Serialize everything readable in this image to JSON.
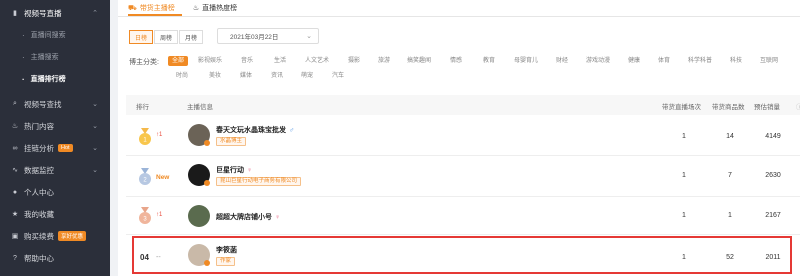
{
  "sidebar": {
    "items": [
      {
        "icon": "chart-icon",
        "label": "视频号直播"
      },
      {
        "icon": "search-icon",
        "label": "视频号查找"
      },
      {
        "icon": "fire-icon",
        "label": "热门内容"
      },
      {
        "icon": "link-icon",
        "label": "挂链分析",
        "badge": "Hot"
      },
      {
        "icon": "monitor-icon",
        "label": "数据监控"
      },
      {
        "icon": "user-icon",
        "label": "个人中心"
      },
      {
        "icon": "star-icon",
        "label": "我的收藏"
      },
      {
        "icon": "cart-icon",
        "label": "购买续费",
        "badge": "享好优惠"
      },
      {
        "icon": "help-icon",
        "label": "帮助中心"
      }
    ],
    "sub_items": [
      "直播间搜索",
      "主播搜索",
      "直播排行榜"
    ]
  },
  "tabs": [
    "带货主播榜",
    "直播热度榜"
  ],
  "periods": [
    "日榜",
    "周榜",
    "月榜"
  ],
  "date": "2021年03月22日",
  "category_label": "博主分类:",
  "categories_row1": [
    "全部",
    "影视娱乐",
    "音乐",
    "生活",
    "人文艺术",
    "摄影",
    "旅游",
    "搞笑趣闻",
    "情感",
    "教育",
    "母婴育儿",
    "财经",
    "游戏动漫",
    "健康",
    "体育",
    "科学科普",
    "科技",
    "互联网"
  ],
  "categories_row2": [
    "时尚",
    "美妆",
    "媒体",
    "资讯",
    "萌宠",
    "汽车"
  ],
  "table": {
    "headers": [
      "排行",
      "主播信息",
      "带货直播场次",
      "带货商品数",
      "预估销量"
    ],
    "rows": [
      {
        "rank": "1",
        "change": "1",
        "name": "春天文玩水晶珠宝批发",
        "tag": "水晶博主",
        "gender": "♂",
        "sessions": "1",
        "products": "14",
        "sales": "4149"
      },
      {
        "rank": "2",
        "change": "New",
        "name": "巨星行动",
        "tag": "昆山巨星行动电子商务有限公司",
        "gender": "♀",
        "sessions": "1",
        "products": "7",
        "sales": "2630"
      },
      {
        "rank": "3",
        "change": "1",
        "name": "超超大牌店铺小号",
        "tag": "",
        "gender": "♀",
        "sessions": "1",
        "products": "1",
        "sales": "2167"
      },
      {
        "rank": "04",
        "change": "--",
        "name": "李筱菡",
        "tag": "作家",
        "gender": "",
        "sessions": "1",
        "products": "52",
        "sales": "2011"
      }
    ]
  },
  "colors": {
    "accent": "#f08a24",
    "sidebar": "#2b2f3a",
    "highlight": "#e53935"
  }
}
